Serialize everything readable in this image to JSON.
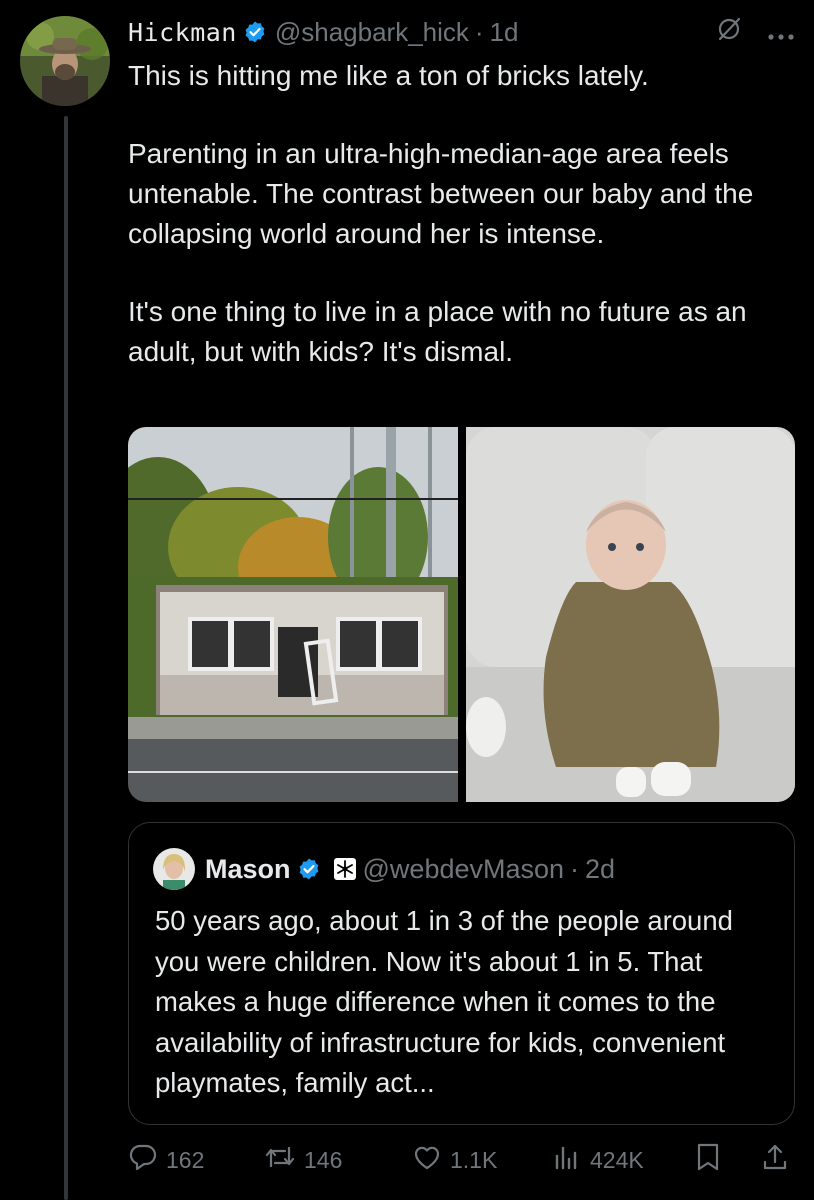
{
  "tweet": {
    "author_name": "Hickman",
    "handle": "@shagbark_hick",
    "time": "1d",
    "paragraphs": [
      "This is hitting me like a ton of bricks lately.",
      "Parenting in an ultra-high-median-age area feels untenable. The contrast between our baby and the collapsing world around her is intense.",
      "It's one thing to live in a place with no future as an adult, but with kids? It's dismal."
    ],
    "images": [
      "abandoned-building-photo",
      "baby-on-couch-photo"
    ]
  },
  "quote": {
    "author_name": "Mason",
    "handle": "@webdevMason",
    "time": "2d",
    "text": "50 years ago, about 1 in 3 of the people around you were children. Now it's about 1 in 5. That makes a huge difference when it comes to the availability of infrastructure for kids, convenient playmates, family act..."
  },
  "actions": {
    "replies": "162",
    "reposts": "146",
    "likes": "1.1K",
    "views": "424K"
  },
  "icons": [
    "verified-badge-icon",
    "grok-icon",
    "more-icon",
    "reply-icon",
    "repost-icon",
    "like-icon",
    "views-icon",
    "bookmark-icon",
    "share-icon"
  ],
  "colors": {
    "background": "#000000",
    "text": "#e7e9ea",
    "muted": "#71767b",
    "verified": "#1d9bf0",
    "border": "#2f3336"
  }
}
